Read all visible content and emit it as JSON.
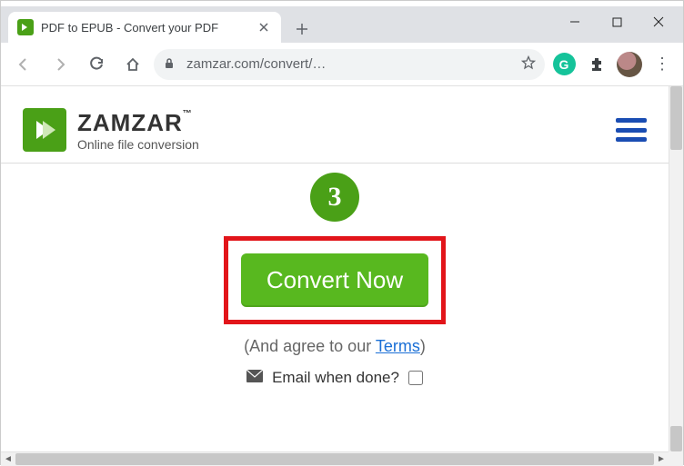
{
  "window": {
    "tab_title": "PDF to EPUB - Convert your PDF"
  },
  "toolbar": {
    "url_display": "zamzar.com/convert/…"
  },
  "site": {
    "brand": "ZAMZAR",
    "trademark": "™",
    "tagline": "Online file conversion"
  },
  "step": {
    "number": "3",
    "button_label": "Convert Now",
    "agree_prefix": "(And agree to our ",
    "agree_link": "Terms",
    "agree_suffix": ")",
    "email_label": "Email when done?",
    "email_checked": false
  },
  "ext": {
    "grammarly_initial": "G"
  }
}
